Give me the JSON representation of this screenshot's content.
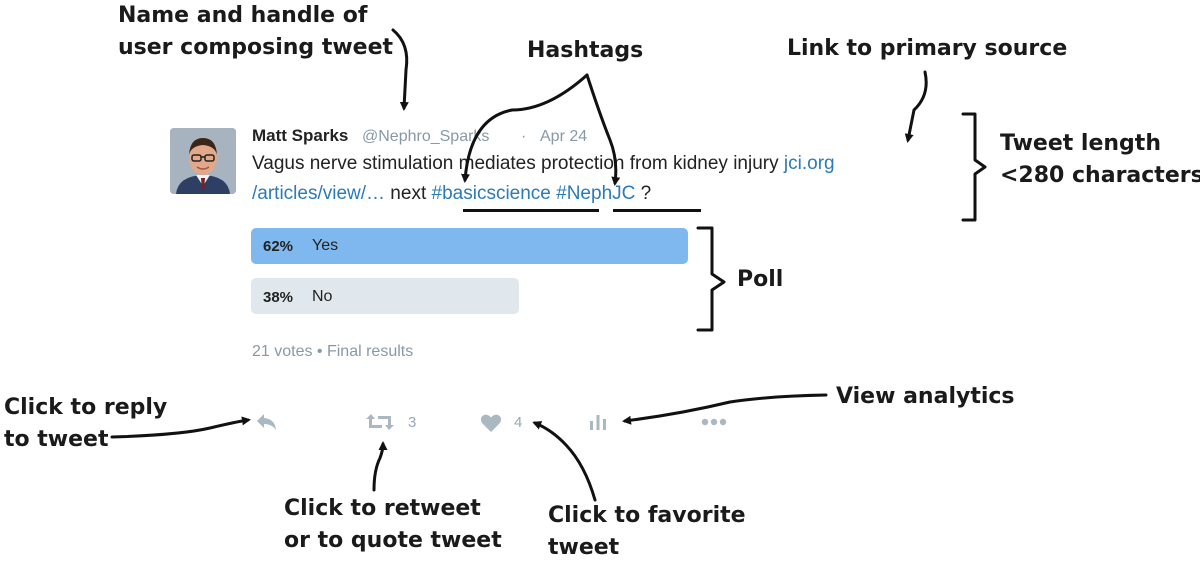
{
  "annotations": {
    "name_handle": [
      "Name and handle of",
      "user composing tweet"
    ],
    "hashtags": "Hashtags",
    "link": "Link to primary source",
    "length": [
      "Tweet length",
      "<280 characters"
    ],
    "poll": "Poll",
    "reply": [
      "Click to reply",
      "to tweet"
    ],
    "retweet": [
      "Click to retweet",
      "or to quote tweet"
    ],
    "favorite": [
      "Click to favorite",
      "tweet"
    ],
    "analytics": "View analytics"
  },
  "tweet": {
    "name": "Matt Sparks",
    "handle": "@Nephro_Sparks",
    "separator": "·",
    "date": "Apr 24",
    "line1_text": "Vagus nerve stimulation mediates protection from kidney injury ",
    "line1_link": "jci.org",
    "line2_link": "/articles/view/…",
    "line2_text": " next ",
    "hashtag1": "#basicscience",
    "hashtag2": "#NephJC",
    "line2_end": " ?"
  },
  "poll": {
    "options": [
      {
        "percent": "62%",
        "label": "Yes",
        "share": 0.62
      },
      {
        "percent": "38%",
        "label": "No",
        "share": 0.38
      }
    ],
    "meta": "21 votes • Final results"
  },
  "actions": {
    "retweet_count": "3",
    "like_count": "4"
  },
  "colors": {
    "link": "#2b7bb9",
    "poll_winner": "#7fb8ee",
    "poll_other": "#e1e8ed",
    "icon": "#aab8c2"
  }
}
